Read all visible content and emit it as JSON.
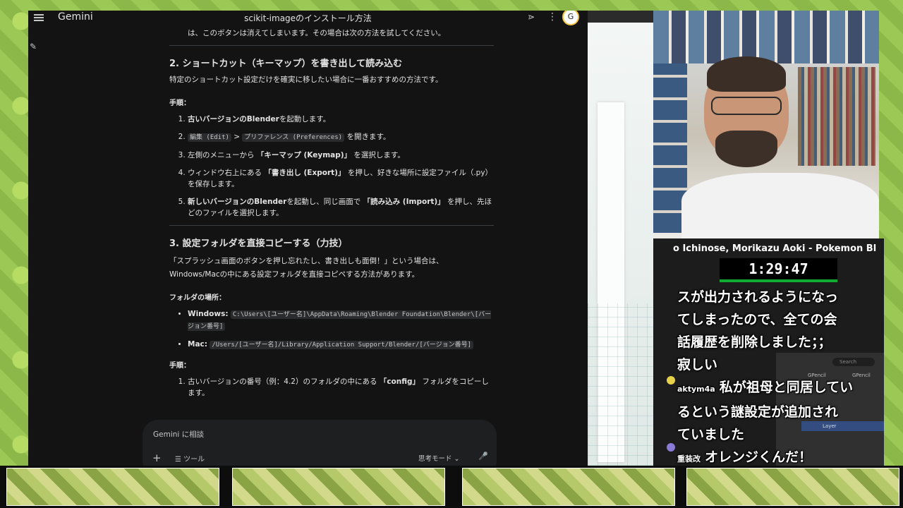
{
  "gemini": {
    "brand": "Gemini",
    "conversation_title": "scikit-imageのインストール方法",
    "icons": {
      "menu": "menu-icon",
      "share": "share-icon",
      "more": "more-vertical-icon",
      "new_chat": "edit-icon",
      "avatar": "avatar-icon"
    },
    "avatar_letter": "G",
    "content": {
      "prev_tail": "は、このボタンは消えてしまいます。その場合は次の方法を試してください。",
      "section2": {
        "heading": "2. ショートカット（キーマップ）を書き出して読み込む",
        "intro": "特定のショートカット設定だけを確実に移したい場合に一番おすすめの方法です。",
        "steps_label": "手順：",
        "step1_bold": "古いバージョンのBlender",
        "step1_rest": "を起動します。",
        "step2_code1": "編集 (Edit)",
        "step2_sep": " > ",
        "step2_code2": "プリファレンス (Preferences)",
        "step2_rest": " を開きます。",
        "step3_pre": "左側のメニューから ",
        "step3_bold": "「キーマップ (Keymap)」",
        "step3_rest": " を選択します。",
        "step4_pre": "ウィンドウ右上にある ",
        "step4_bold": "「書き出し (Export)」",
        "step4_rest": " を押し、好きな場所に設定ファイル（.py）を保存します。",
        "step5_bold1": "新しいバージョンのBlender",
        "step5_mid": "を起動し、同じ画面で ",
        "step5_bold2": "「読み込み (Import)」",
        "step5_rest": " を押し、先ほどのファイルを選択します。"
      },
      "section3": {
        "heading": "3. 設定フォルダを直接コピーする（力技）",
        "intro_line1": "「スプラッシュ画面のボタンを押し忘れたし、書き出しも面倒！」という場合は、",
        "intro_line2": "Windows/Macの中にある設定フォルダを直接コピペする方法があります。",
        "folder_label": "フォルダの場所：",
        "windows_label": "Windows:",
        "windows_path": "C:\\Users\\[ユーザー名]\\AppData\\Roaming\\Blender Foundation\\Blender\\[バージョン番号]",
        "mac_label": "Mac:",
        "mac_path": "/Users/[ユーザー名]/Library/Application Support/Blender/[バージョン番号]",
        "steps_label": "手順：",
        "step1_pre": "古いバージョンの番号（例：4.2）のフォルダの中にある ",
        "step1_bold": "「config」",
        "step1_rest": " フォルダをコピーします。"
      }
    },
    "composer": {
      "placeholder": "Gemini に相談",
      "add_icon": "plus-icon",
      "tools_label": "ツール",
      "mode_label": "思考モード",
      "mic_icon": "mic-icon"
    }
  },
  "stream": {
    "track_title": "o Ichinose, Morikazu Aoki - Pokemon Bl",
    "timer": "1:29:47",
    "blender_mini": {
      "search_placeholder": "Search",
      "crumb1": "GPencil",
      "crumb2": "GPencil",
      "layer": "Layer"
    },
    "chat": [
      {
        "user": "",
        "text": "スが出力されるようになっ"
      },
      {
        "user": "",
        "text": "てしまったので、全ての会"
      },
      {
        "user": "",
        "text": "話履歴を削除しました；；"
      },
      {
        "user": "",
        "text": "寂しい"
      },
      {
        "user": "aktym4a",
        "text": "私が祖母と同居してい"
      },
      {
        "user": "",
        "text": "るという謎設定が追加され"
      },
      {
        "user": "",
        "text": "ていました"
      },
      {
        "user": "重装改",
        "text": "オレンジくんだ！"
      }
    ],
    "colors": {
      "timer_bar": "#11aa33",
      "accent": "#334d80"
    }
  }
}
